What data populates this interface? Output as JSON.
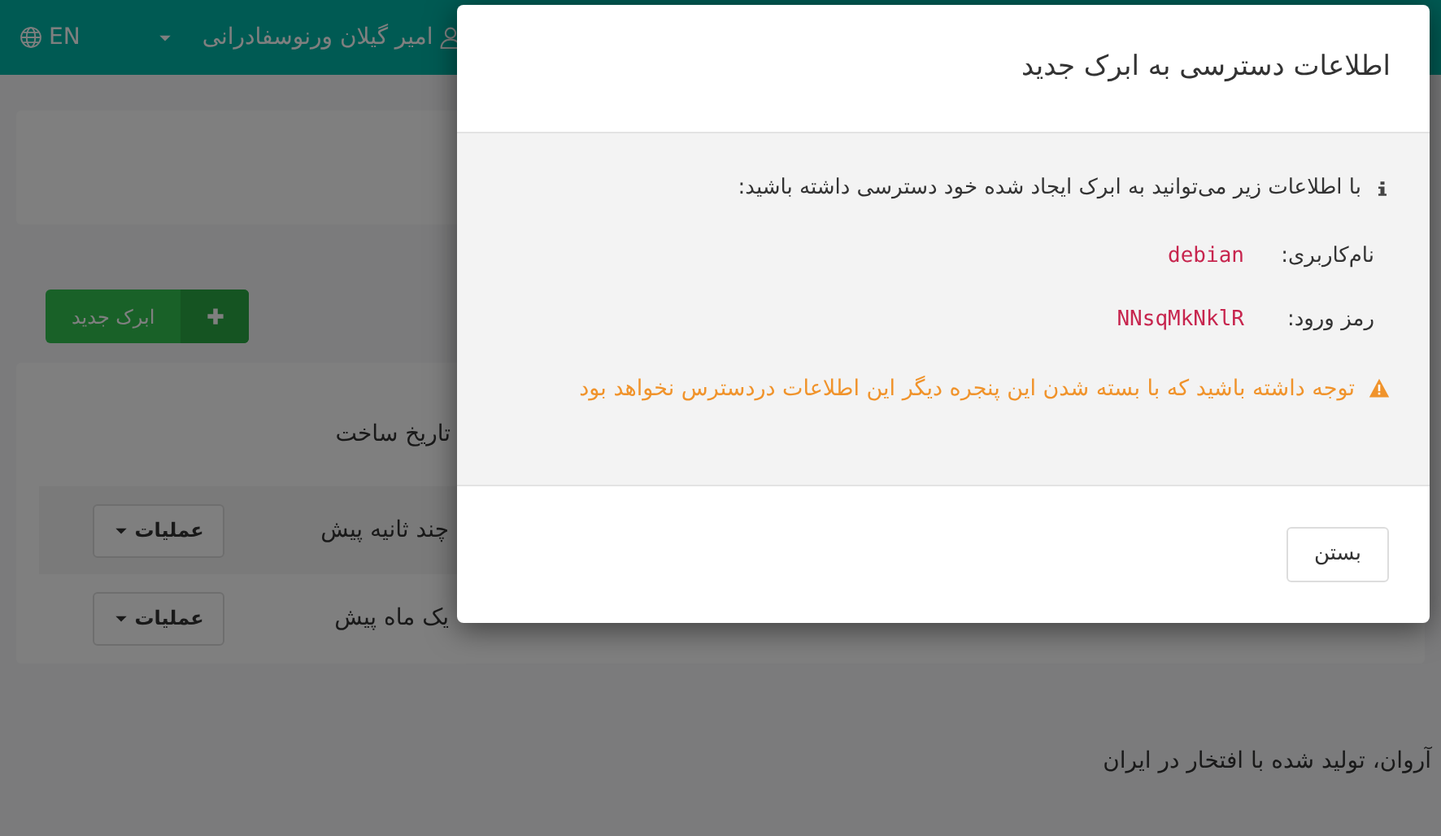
{
  "navbar": {
    "language": "EN",
    "user": "امیر گیلان ورنوسفادرانی"
  },
  "toolbar": {
    "new_button": "ابرک جدید"
  },
  "table": {
    "columns": [
      "تاریخ ساخت"
    ],
    "rows": [
      {
        "created": "چند ثانیه پیش",
        "actions": "عملیات"
      },
      {
        "created": "یک ماه پیش",
        "actions": "عملیات"
      }
    ]
  },
  "footer": "آروان، تولید شده با افتخار در ایران",
  "modal": {
    "title": "اطلاعات دسترسی به ابرک جدید",
    "intro": "با اطلاعات زیر می‌توانید به ابرک ایجاد شده خود دسترسی داشته باشید:",
    "fields": [
      {
        "label": "نام‌کاربری:",
        "value": "debian"
      },
      {
        "label": "رمز ورود:",
        "value": "NNsqMkNklR"
      }
    ],
    "warning": "توجه داشته باشید که با بسته شدن این پنجره دیگر این اطلاعات دردسترس نخواهد بود",
    "close_button": "بستن"
  }
}
